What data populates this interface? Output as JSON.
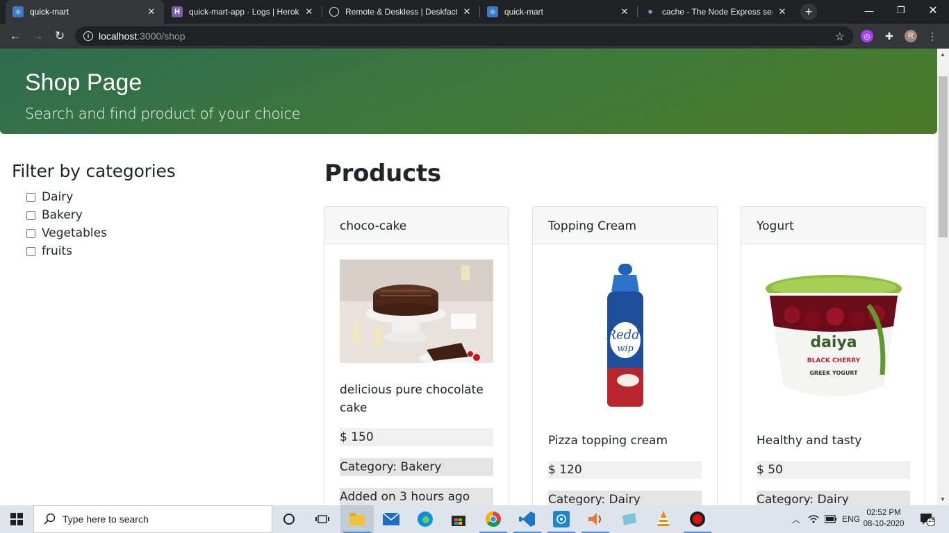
{
  "browser": {
    "tabs": [
      {
        "title": "quick-mart",
        "icon": "react-icon"
      },
      {
        "title": "quick-mart-app · Logs | Heroku",
        "icon": "heroku-icon"
      },
      {
        "title": "Remote & Deskless | Deskfactor",
        "icon": "globe-icon"
      },
      {
        "title": "quick-mart",
        "icon": "react-icon"
      },
      {
        "title": "cache - The Node Express server",
        "icon": "node-icon"
      }
    ],
    "url_host": "localhost",
    "url_path": ":3000/shop",
    "profile_initial": "R"
  },
  "hero": {
    "title": "Shop Page",
    "subtitle": "Search and find product of your choice"
  },
  "filter": {
    "title": "Filter by categories",
    "categories": [
      "Dairy",
      "Bakery",
      "Vegetables",
      "fruits"
    ]
  },
  "products": {
    "title": "Products",
    "items": [
      {
        "name": "choco-cake",
        "description": "delicious pure chocolate cake",
        "price": "$ 150",
        "category": "Category: Bakery",
        "added": "Added on 3 hours ago"
      },
      {
        "name": "Topping Cream",
        "description": "Pizza topping cream",
        "price": "$ 120",
        "category": "Category: Dairy"
      },
      {
        "name": "Yogurt",
        "description": "Healthy and tasty",
        "price": "$ 50",
        "category": "Category: Dairy"
      }
    ]
  },
  "taskbar": {
    "search_placeholder": "Type here to search",
    "language": "ENG",
    "time": "02:52 PM",
    "date": "08-10-2020",
    "notifications": "15"
  }
}
